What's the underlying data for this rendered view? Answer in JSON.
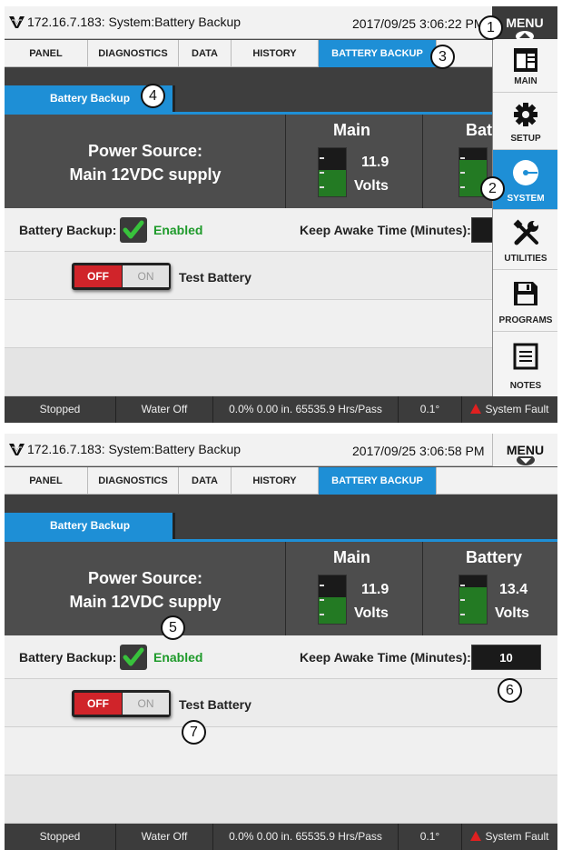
{
  "panel1": {
    "title": "172.16.7.183: System:Battery Backup",
    "datetime": "2017/09/25 3:06:22 PM",
    "menu_label": "MENU"
  },
  "panel2": {
    "title": "172.16.7.183: System:Battery Backup",
    "datetime": "2017/09/25 3:06:58 PM",
    "menu_label": "MENU"
  },
  "tabs": [
    "PANEL",
    "DIAGNOSTICS",
    "DATA",
    "HISTORY",
    "BATTERY BACKUP"
  ],
  "active_tab": "BATTERY BACKUP",
  "subtab_label": "Battery Backup",
  "power_source": {
    "line1": "Power Source:",
    "line2": "Main 12VDC supply"
  },
  "main": {
    "title": "Main",
    "value": "11.9",
    "unit": "Volts",
    "level": 0.55
  },
  "battery": {
    "title": "Battery",
    "value": "13.4",
    "unit": "Volts",
    "level": 0.75
  },
  "battery_backup": {
    "label": "Battery Backup:",
    "status": "Enabled",
    "checked": true
  },
  "keep_awake": {
    "label": "Keep Awake Time (Minutes):",
    "value": "10"
  },
  "test_battery": {
    "off_label": "OFF",
    "on_label": "ON",
    "label": "Test Battery"
  },
  "status_bar": {
    "state": "Stopped",
    "water": "Water Off",
    "readout": "0.0%  0.00 in.  65535.9 Hrs/Pass",
    "angle": "0.1°",
    "fault": "System Fault"
  },
  "side_menu": [
    {
      "label": "MAIN",
      "icon": "main-panel-icon"
    },
    {
      "label": "SETUP",
      "icon": "gear-icon"
    },
    {
      "label": "SYSTEM",
      "icon": "system-icon"
    },
    {
      "label": "UTILITIES",
      "icon": "tools-icon"
    },
    {
      "label": "PROGRAMS",
      "icon": "floppy-disk-icon"
    },
    {
      "label": "NOTES",
      "icon": "notes-icon"
    }
  ],
  "active_side_menu": "SYSTEM",
  "callouts": [
    "1",
    "2",
    "3",
    "4",
    "5",
    "6",
    "7"
  ],
  "colors": {
    "accent": "#1e8fd6",
    "enabled": "#1e9a2a",
    "off": "#d0242a",
    "fault": "#e02020"
  }
}
